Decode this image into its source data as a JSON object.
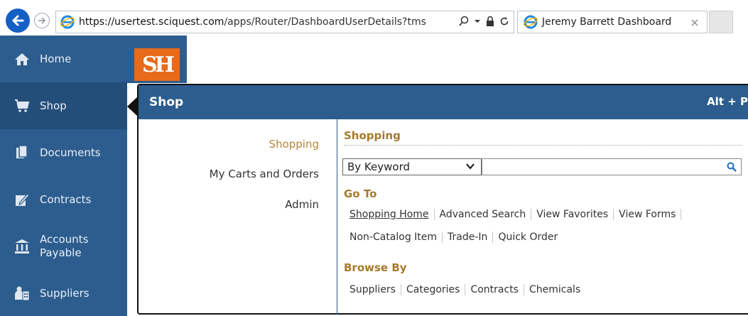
{
  "browser": {
    "url_host": "https://usertest.sciquest.com",
    "url_path": "/apps/Router/DashboardUserDetails?tms",
    "tab_title": "Jeremy Barrett Dashboard",
    "tab_close": "×"
  },
  "sidebar": {
    "items": [
      {
        "label": "Home",
        "icon": "home-icon"
      },
      {
        "label": "Shop",
        "icon": "cart-icon"
      },
      {
        "label": "Documents",
        "icon": "documents-icon"
      },
      {
        "label": "Contracts",
        "icon": "contract-icon"
      },
      {
        "label": "Accounts",
        "label2": "Payable",
        "icon": "bank-icon"
      },
      {
        "label": "Suppliers",
        "icon": "supplier-icon"
      }
    ]
  },
  "logo": {
    "text": "SH"
  },
  "panel": {
    "title": "Shop",
    "shortcut": "Alt + P",
    "left_links": [
      "Shopping",
      "My Carts and Orders",
      "Admin"
    ],
    "shopping_title": "Shopping",
    "search_by": "By Keyword",
    "search_value": "",
    "goto_title": "Go To",
    "goto_row1": [
      "Shopping Home",
      "Advanced Search",
      "View Favorites",
      "View Forms"
    ],
    "goto_row2": [
      "Non-Catalog Item",
      "Trade-In",
      "Quick Order"
    ],
    "browse_title": "Browse By",
    "browse_row": [
      "Suppliers",
      "Categories",
      "Contracts",
      "Chemicals"
    ]
  },
  "colors": {
    "sidebar": "#2c5d8e",
    "accent_gold": "#a57a2e",
    "logo_orange": "#e86a1b"
  }
}
